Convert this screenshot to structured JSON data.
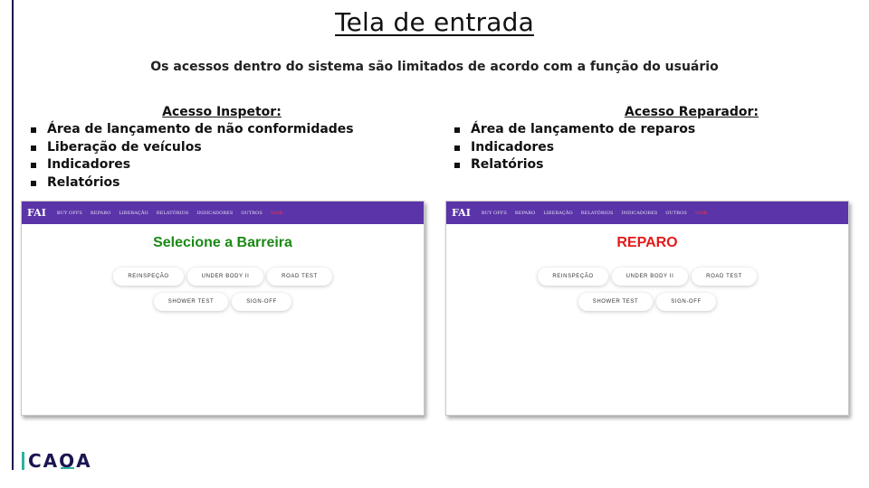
{
  "slide": {
    "title": "Tela de entrada",
    "subtitle": "Os acessos dentro do sistema são limitados de acordo com a função do usuário"
  },
  "inspetor": {
    "heading": "Acesso Inspetor:",
    "items": [
      "Área de lançamento de não conformidades",
      "Liberação de veículos",
      "Indicadores",
      "Relatórios"
    ]
  },
  "reparador": {
    "heading": "Acesso Reparador:",
    "items": [
      "Área de lançamento de reparos",
      "Indicadores",
      "Relatórios"
    ]
  },
  "mock_left": {
    "brand": "FAI",
    "nav": [
      "BUY OFFS",
      "REPARO",
      "LIBERAÇÃO",
      "RELATÓRIOS",
      "INDICADORES",
      "OUTROS",
      "SAIR"
    ],
    "screen_title": "Selecione a Barreira",
    "title_color": "#1a8a14",
    "buttons_row1": [
      "REINSPEÇÃO",
      "UNDER BODY II",
      "ROAD TEST"
    ],
    "buttons_row2": [
      "SHOWER TEST",
      "SIGN-OFF"
    ]
  },
  "mock_right": {
    "brand": "FAI",
    "nav": [
      "BUY OFFS",
      "REPARO",
      "LIBERAÇÃO",
      "RELATÓRIOS",
      "INDICADORES",
      "OUTROS",
      "SAIR"
    ],
    "screen_title": "REPARO",
    "title_color": "#e41b1b",
    "buttons_row1": [
      "REINSPEÇÃO",
      "UNDER BODY II",
      "ROAD TEST"
    ],
    "buttons_row2": [
      "SHOWER TEST",
      "SIGN-OFF"
    ]
  },
  "colors": {
    "navbar": "#5a34a8",
    "logo_dark": "#1b1552",
    "logo_accent": "#2bb39a"
  },
  "logo": {
    "text_a": "CA",
    "text_b": "O",
    "text_c": "A"
  }
}
